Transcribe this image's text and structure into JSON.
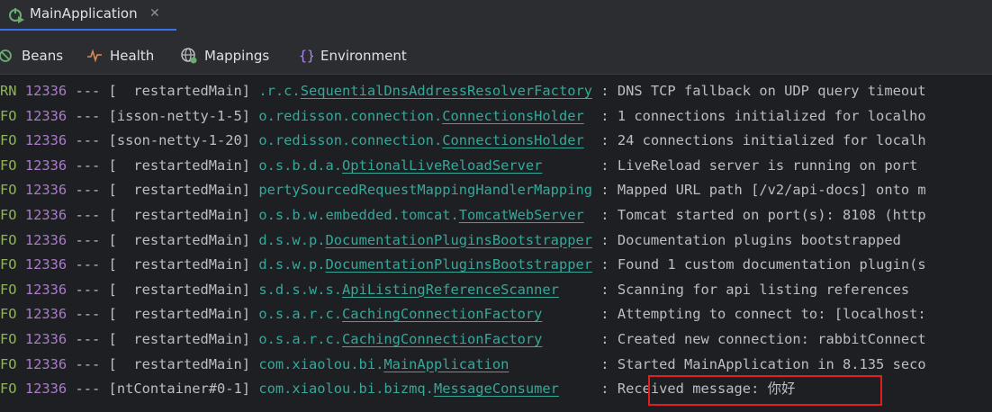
{
  "run_tab": {
    "title": "MainApplication",
    "close": "✕"
  },
  "toolbar": {
    "items": [
      {
        "label": "Beans",
        "icon": "beans-icon"
      },
      {
        "label": "Health",
        "icon": "health-icon"
      },
      {
        "label": "Mappings",
        "icon": "mappings-icon"
      },
      {
        "label": "Environment",
        "icon": "environment-icon"
      }
    ]
  },
  "console": {
    "lines": [
      {
        "level": "RN",
        "pid": "12336",
        "sep": "---",
        "thread": "[  restartedMain]",
        "pkg": ".r.c.",
        "cls": "SequentialDnsAddressResolverFactory",
        "colon": ":",
        "msg": "DNS TCP fallback on UDP query timeout"
      },
      {
        "level": "FO",
        "pid": "12336",
        "sep": "---",
        "thread": "[isson-netty-1-5]",
        "pkg": "o.redisson.connection.",
        "cls": "ConnectionsHolder",
        "colon": ":",
        "msg": "1 connections initialized for localho"
      },
      {
        "level": "FO",
        "pid": "12336",
        "sep": "---",
        "thread": "[sson-netty-1-20]",
        "pkg": "o.redisson.connection.",
        "cls": "ConnectionsHolder",
        "colon": ":",
        "msg": "24 connections initialized for localh"
      },
      {
        "level": "FO",
        "pid": "12336",
        "sep": "---",
        "thread": "[  restartedMain]",
        "pkg": "o.s.b.d.a.",
        "cls": "OptionalLiveReloadServer",
        "colon": ":",
        "msg": "LiveReload server is running on port"
      },
      {
        "level": "FO",
        "pid": "12336",
        "sep": "---",
        "thread": "[  restartedMain]",
        "pkg": "pertySourcedRequestMappingHandlerMapping",
        "cls": "",
        "colon": ":",
        "msg": "Mapped URL path [/v2/api-docs] onto m"
      },
      {
        "level": "FO",
        "pid": "12336",
        "sep": "---",
        "thread": "[  restartedMain]",
        "pkg": "o.s.b.w.embedded.tomcat.",
        "cls": "TomcatWebServer",
        "colon": ":",
        "msg": "Tomcat started on port(s): 8108 (http"
      },
      {
        "level": "FO",
        "pid": "12336",
        "sep": "---",
        "thread": "[  restartedMain]",
        "pkg": "d.s.w.p.",
        "cls": "DocumentationPluginsBootstrapper",
        "colon": ":",
        "msg": "Documentation plugins bootstrapped"
      },
      {
        "level": "FO",
        "pid": "12336",
        "sep": "---",
        "thread": "[  restartedMain]",
        "pkg": "d.s.w.p.",
        "cls": "DocumentationPluginsBootstrapper",
        "colon": ":",
        "msg": "Found 1 custom documentation plugin(s"
      },
      {
        "level": "FO",
        "pid": "12336",
        "sep": "---",
        "thread": "[  restartedMain]",
        "pkg": "s.d.s.w.s.",
        "cls": "ApiListingReferenceScanner",
        "colon": ":",
        "msg": "Scanning for api listing references"
      },
      {
        "level": "FO",
        "pid": "12336",
        "sep": "---",
        "thread": "[  restartedMain]",
        "pkg": "o.s.a.r.c.",
        "cls": "CachingConnectionFactory",
        "colon": ":",
        "msg": "Attempting to connect to: [localhost:"
      },
      {
        "level": "FO",
        "pid": "12336",
        "sep": "---",
        "thread": "[  restartedMain]",
        "pkg": "o.s.a.r.c.",
        "cls": "CachingConnectionFactory",
        "colon": ":",
        "msg": "Created new connection: rabbitConnect"
      },
      {
        "level": "FO",
        "pid": "12336",
        "sep": "---",
        "thread": "[  restartedMain]",
        "pkg": "com.xiaolou.bi.",
        "cls": "MainApplication",
        "colon": ":",
        "msg": "Started MainApplication in 8.135 seco"
      },
      {
        "level": "FO",
        "pid": "12336",
        "sep": "---",
        "thread": "[ntContainer#0-1]",
        "pkg": "com.xiaolou.bi.bizmq.",
        "cls": "MessageConsumer",
        "colon": ":",
        "msg": "Received message: 你好"
      }
    ]
  },
  "colors": {
    "accent": "#3574f0",
    "highlight": "#e02020",
    "logger": "#37a79a",
    "level_info": "#8fb45b",
    "pid": "#a87cc7"
  }
}
